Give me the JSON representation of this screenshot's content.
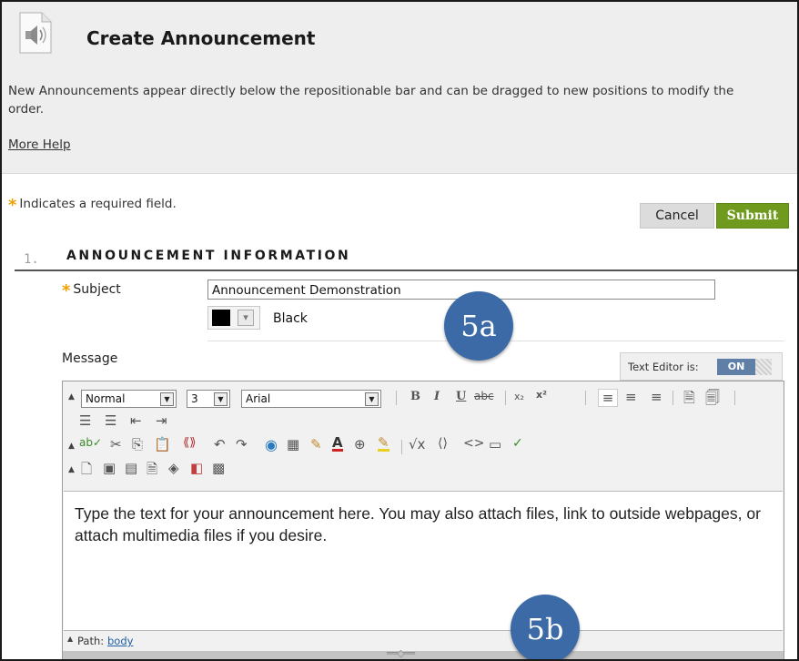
{
  "header": {
    "icon": "speaker-icon",
    "title": "Create Announcement",
    "description": "New Announcements appear directly below the repositionable bar and can be dragged to new positions to modify the order.",
    "more_help": "More Help"
  },
  "form": {
    "required_note": "Indicates a required field.",
    "required_marker": "*",
    "buttons": {
      "cancel": "Cancel",
      "submit": "Submit"
    },
    "section": {
      "number": "1.",
      "title": "ANNOUNCEMENT INFORMATION"
    },
    "subject": {
      "label": "Subject",
      "value": "Announcement Demonstration"
    },
    "text_color": {
      "swatch": "#000000",
      "name": "Black"
    },
    "message_label": "Message"
  },
  "editor": {
    "toggle_label": "Text Editor is:",
    "toggle_state": "ON",
    "toolbar": {
      "format": "Normal",
      "size": "3",
      "font": "Arial"
    },
    "content": "Type the text for your announcement here. You may also attach files, link to outside webpages, or attach multimedia files if you desire.",
    "status": {
      "path_label": "Path:",
      "path_value": "body"
    }
  },
  "callouts": {
    "first": "5a",
    "second": "5b"
  },
  "colors": {
    "submit": "#6f9a1e",
    "accent_star": "#f0a000",
    "callout": "#3b6aa6",
    "toggle_on": "#5f7fa6"
  }
}
